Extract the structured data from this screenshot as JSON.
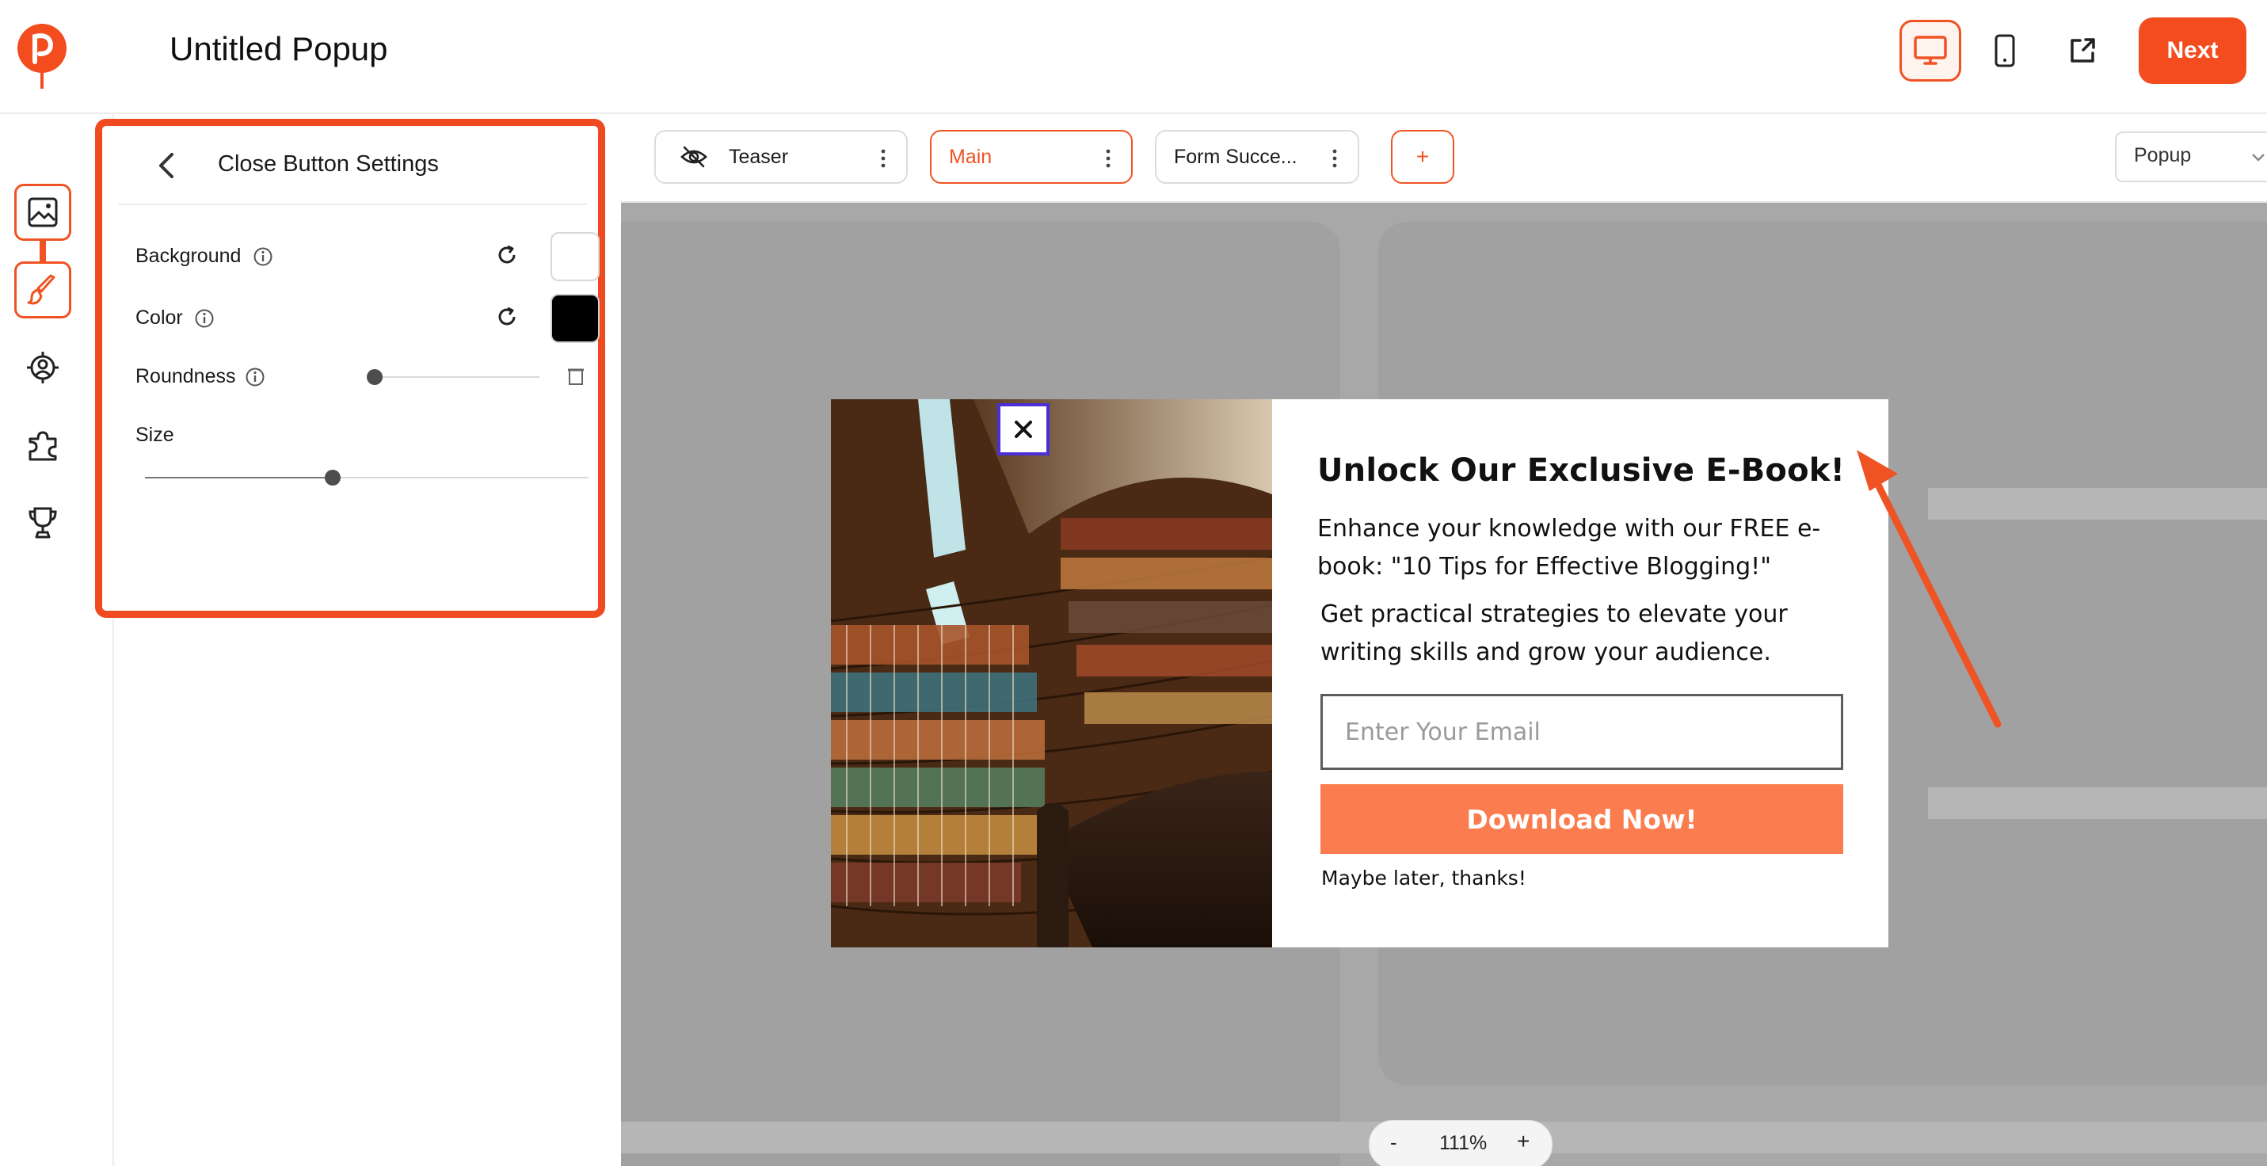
{
  "header": {
    "title": "Untitled Popup",
    "next_label": "Next",
    "desktop_icon": "desktop-icon",
    "mobile_icon": "mobile-icon",
    "external_icon": "external-link-icon",
    "brand_color": "#f24c1f"
  },
  "rail": {
    "items": [
      "image-icon",
      "brush-icon",
      "target-icon",
      "puzzle-icon",
      "trophy-icon"
    ]
  },
  "panel": {
    "title": "Close Button Settings",
    "background_label": "Background",
    "color_label": "Color",
    "roundness_label": "Roundness",
    "size_label": "Size",
    "background_value": "#ffffff",
    "color_value": "#000000",
    "roundness_value": 0,
    "size_value": 0.42
  },
  "tabs": {
    "items": [
      {
        "label": "Teaser"
      },
      {
        "label": "Main"
      },
      {
        "label": "Form Succe..."
      }
    ],
    "add_label": "+",
    "select_value": "Popup"
  },
  "popup": {
    "heading": "Unlock Our Exclusive E-Book!",
    "p1": "Enhance your knowledge with our FREE e-book: \"10 Tips for Effective Blogging!\"",
    "p2": "Get practical strategies to elevate your writing skills and grow your audience.",
    "email_placeholder": "Enter Your Email",
    "button_label": "Download Now!",
    "maybe_label": "Maybe later, thanks!",
    "close_symbol": "✕",
    "button_color": "#fb7d4f"
  },
  "zoom": {
    "minus": "-",
    "value": "111%",
    "plus": "+"
  }
}
